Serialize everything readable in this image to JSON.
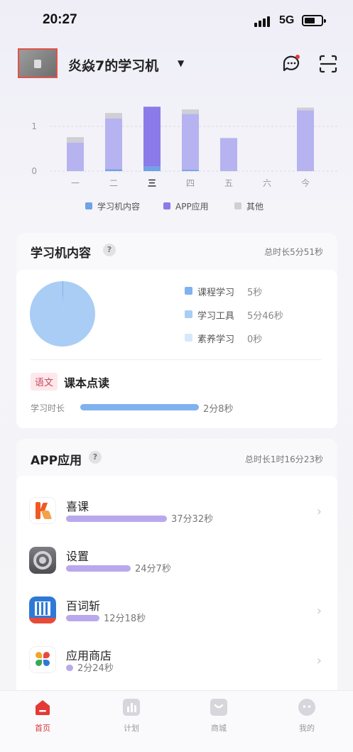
{
  "status_bar": {
    "time": "20:27",
    "network": "5G"
  },
  "header": {
    "device_name": "炎焱7的学习机"
  },
  "chart_data": {
    "type": "bar",
    "categories": [
      "一",
      "二",
      "三",
      "四",
      "五",
      "六",
      "今"
    ],
    "yticks": [
      "0",
      "1"
    ],
    "ylim": [
      0,
      1.6
    ],
    "series": [
      {
        "name": "学习机内容",
        "color": "#6fa3e8",
        "values": [
          0,
          0.04,
          0.1,
          0.03,
          0,
          0,
          0
        ]
      },
      {
        "name": "APP应用",
        "color_today": "#8a7be8",
        "color": "#b6b3f0",
        "values": [
          0.64,
          1.14,
          1.34,
          1.25,
          0.74,
          0,
          1.36
        ]
      },
      {
        "name": "其他",
        "color": "#cfcfd4",
        "values": [
          0.12,
          0.12,
          0.0,
          0.1,
          0,
          0,
          0.06
        ]
      }
    ],
    "legend": [
      "学习机内容",
      "APP应用",
      "其他"
    ],
    "highlight": "三"
  },
  "learning_card": {
    "title": "学习机内容",
    "total": "总时长5分51秒",
    "pie": {
      "values": [
        1,
        345,
        0
      ]
    },
    "legend": [
      {
        "label": "课程学习",
        "value": "5秒",
        "color": "#7fb2ee"
      },
      {
        "label": "学习工具",
        "value": "5分46秒",
        "color": "#a9cdf5"
      },
      {
        "label": "素养学习",
        "value": "0秒",
        "color": "#d6e8fb"
      }
    ],
    "subject_tag": "语文",
    "book_title": "课本点读",
    "study_label": "学习时长",
    "study_value": "2分8秒",
    "study_fraction": 0.95
  },
  "app_card": {
    "title": "APP应用",
    "total": "总时长1时16分23秒",
    "apps": [
      {
        "name": "喜课",
        "time": "37分32秒",
        "fraction": 0.78,
        "icon": "xike-app-icon"
      },
      {
        "name": "设置",
        "time": "24分7秒",
        "fraction": 0.5,
        "icon": "settings-app-icon"
      },
      {
        "name": "百词斩",
        "time": "12分18秒",
        "fraction": 0.26,
        "icon": "baicizhan-app-icon"
      },
      {
        "name": "应用商店",
        "time": "2分24秒",
        "fraction": 0.05,
        "icon": "app-store-icon"
      }
    ]
  },
  "tabbar": {
    "items": [
      {
        "label": "首页",
        "active": true
      },
      {
        "label": "计划",
        "active": false
      },
      {
        "label": "商城",
        "active": false
      },
      {
        "label": "我的",
        "active": false
      }
    ]
  }
}
